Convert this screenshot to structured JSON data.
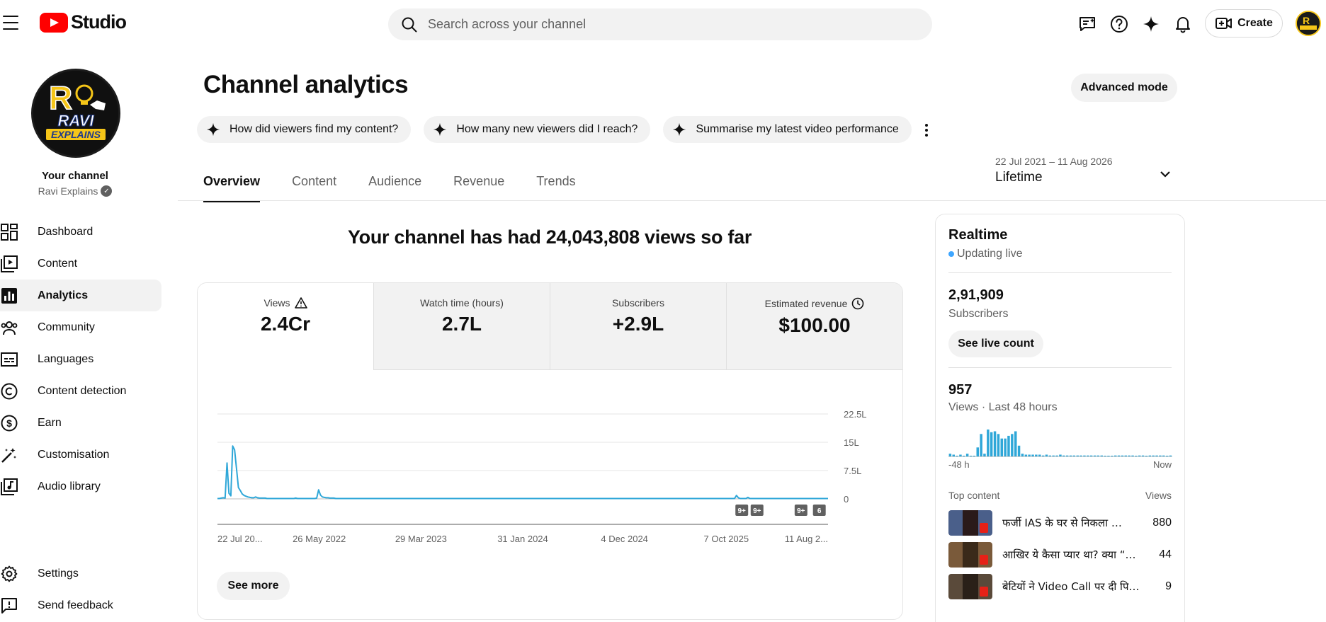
{
  "app": {
    "title": "Studio"
  },
  "search": {
    "placeholder": "Search across your channel"
  },
  "header": {
    "create_label": "Create"
  },
  "sidebar": {
    "your_channel": "Your channel",
    "channel_name": "Ravi Explains",
    "avatar_text": {
      "line1": "RAVI",
      "line2": "EXPLAINS"
    },
    "items": [
      {
        "label": "Dashboard",
        "icon": "dashboard-icon"
      },
      {
        "label": "Content",
        "icon": "content-icon"
      },
      {
        "label": "Analytics",
        "icon": "analytics-icon",
        "active": true
      },
      {
        "label": "Community",
        "icon": "community-icon"
      },
      {
        "label": "Languages",
        "icon": "subtitles-icon"
      },
      {
        "label": "Content detection",
        "icon": "copyright-icon"
      },
      {
        "label": "Earn",
        "icon": "dollar-icon"
      },
      {
        "label": "Customisation",
        "icon": "magic-wand-icon"
      },
      {
        "label": "Audio library",
        "icon": "audio-library-icon"
      }
    ],
    "bottom": [
      {
        "label": "Settings",
        "icon": "gear-icon"
      },
      {
        "label": "Send feedback",
        "icon": "feedback-icon"
      }
    ]
  },
  "main": {
    "title": "Channel analytics",
    "advanced_mode": "Advanced mode",
    "chips": [
      "How did viewers find my content?",
      "How many new viewers did I reach?",
      "Summarise my latest video performance"
    ],
    "tabs": [
      "Overview",
      "Content",
      "Audience",
      "Revenue",
      "Trends"
    ],
    "date_range": {
      "range": "22 Jul 2021 – 11 Aug 2026",
      "label": "Lifetime"
    },
    "headline": "Your channel has had 24,043,808 views so far",
    "metrics": [
      {
        "label": "Views",
        "value": "2.4Cr"
      },
      {
        "label": "Watch time (hours)",
        "value": "2.7L"
      },
      {
        "label": "Subscribers",
        "value": "+2.9L"
      },
      {
        "label": "Estimated revenue",
        "value": "$100.00"
      }
    ],
    "see_more": "See more"
  },
  "chart_data": {
    "type": "line",
    "series": [
      {
        "values": [
          0.1,
          0.1,
          0.2,
          0.3,
          0.2,
          9.5,
          1.5,
          0.8,
          14.0,
          13.0,
          8.0,
          3.0,
          2.2,
          1.3,
          0.9,
          0.7,
          0.5,
          0.4,
          0.3,
          0.3,
          0.5,
          0.3,
          0.2,
          0.2,
          0.2,
          0.2,
          0.1,
          0.1,
          0.1,
          0.1,
          0.1,
          0.1,
          0.1,
          0.1,
          0.1,
          0.1,
          0.1,
          0.1,
          0.1,
          0.1,
          0.1,
          0.2,
          0.1,
          0.1,
          0.1,
          0.1,
          0.1,
          0.1,
          0.1,
          0.1,
          0.1,
          0.1,
          0.2,
          2.4,
          1.0,
          0.5,
          0.4,
          0.3,
          0.3,
          0.2,
          0.2,
          0.2,
          0.1,
          0.1,
          0.1,
          0.1,
          0.1,
          0.1,
          0.1,
          0.1,
          0.1,
          0.1,
          0.1,
          0.1,
          0.1,
          0.1,
          0.1,
          0.1,
          0.1,
          0.1,
          0.1,
          0.1,
          0.1,
          0.1,
          0.1,
          0.1,
          0.1,
          0.1,
          0.1,
          0.1,
          0.1,
          0.1,
          0.1,
          0.1,
          0.1,
          0.1,
          0.1,
          0.1,
          0.1,
          0.1,
          0.1,
          0.1,
          0.1,
          0.1,
          0.1,
          0.1,
          0.1,
          0.1,
          0.1,
          0.1,
          0.1,
          0.1,
          0.1,
          0.1,
          0.1,
          0.1,
          0.1,
          0.1,
          0.1,
          0.1,
          0.1,
          0.1,
          0.1,
          0.1,
          0.1,
          0.1,
          0.1,
          0.1,
          0.1,
          0.1,
          0.1,
          0.1,
          0.1,
          0.1,
          0.1,
          0.1,
          0.1,
          0.1,
          0.1,
          0.1,
          0.1,
          0.1,
          0.1,
          0.1,
          0.1,
          0.1,
          0.1,
          0.1,
          0.1,
          0.1,
          0.1,
          0.1,
          0.1,
          0.1,
          0.1,
          0.1,
          0.1,
          0.1,
          0.1,
          0.1,
          0.1,
          0.1,
          0.1,
          0.1,
          0.1,
          0.1,
          0.1,
          0.1,
          0.1,
          0.1,
          0.1,
          0.1,
          0.1,
          0.1,
          0.1,
          0.1,
          0.1,
          0.1,
          0.1,
          0.1,
          0.1,
          0.1,
          0.1,
          0.1,
          0.1,
          0.1,
          0.1,
          0.1,
          0.1,
          0.1,
          0.1,
          0.1,
          0.1,
          0.1,
          0.1,
          0.1,
          0.1,
          0.1,
          0.1,
          0.1,
          0.1,
          0.1,
          0.1,
          0.1,
          0.1,
          0.1,
          0.1,
          0.1,
          0.1,
          0.1,
          0.1,
          0.1,
          0.1,
          0.1,
          0.1,
          0.1,
          0.1,
          0.1,
          0.1,
          0.1,
          0.1,
          0.1,
          0.1,
          0.1,
          0.1,
          0.1,
          0.1,
          0.1,
          0.1,
          0.1,
          0.1,
          0.1,
          0.1,
          0.1,
          0.1,
          0.1,
          0.1,
          0.1,
          0.1,
          0.1,
          0.1,
          0.1,
          0.1,
          0.1,
          0.1,
          0.1,
          0.1,
          0.1,
          0.1,
          0.1,
          0.1,
          0.1,
          0.1,
          0.1,
          0.1,
          0.1,
          0.1,
          0.1,
          0.1,
          0.1,
          0.1,
          0.1,
          0.1,
          0.1,
          0.1,
          0.1,
          0.1,
          0.1,
          0.1,
          0.1,
          0.1,
          0.1,
          0.9,
          0.3,
          0.1,
          0.1,
          0.1,
          0.1,
          0.4,
          0.1,
          0.1,
          0.1,
          0.1,
          0.1,
          0.1,
          0.1,
          0.1,
          0.1,
          0.1,
          0.1,
          0.1,
          0.1,
          0.1,
          0.1,
          0.1,
          0.1,
          0.1,
          0.1,
          0.1,
          0.1,
          0.1,
          0.1,
          0.1,
          0.1,
          0.1,
          0.1,
          0.1,
          0.1,
          0.1,
          0.1,
          0.1,
          0.1,
          0.1,
          0.1,
          0.1,
          0.1,
          0.1,
          0.1,
          0.1,
          0.1,
          0.1
        ]
      }
    ],
    "ytick_labels": [
      "0",
      "7.5L",
      "15L",
      "22.5L"
    ],
    "ytick_values": [
      0,
      7.5,
      15,
      22.5
    ],
    "ylim": [
      0,
      22.5
    ],
    "xtick_labels": [
      "22 Jul 20...",
      "26 May 2022",
      "29 Mar 2023",
      "31 Jan 2024",
      "4 Dec 2024",
      "7 Oct 2025",
      "11 Aug 2..."
    ],
    "markers": [
      "9+",
      "9+",
      "9+",
      "6"
    ],
    "grid": true,
    "color": "#2fa7d8"
  },
  "realtime": {
    "title": "Realtime",
    "updating": "Updating live",
    "subscribers_value": "2,91,909",
    "subscribers_label": "Subscribers",
    "see_live_count": "See live count",
    "views_value": "957",
    "views_label": "Views · Last 48 hours",
    "axis_start": "-48 h",
    "axis_end": "Now",
    "bars": [
      3,
      2,
      0,
      2,
      0,
      3,
      0,
      0,
      10,
      25,
      3,
      30,
      27,
      28,
      25,
      20,
      20,
      23,
      25,
      28,
      12,
      3,
      2,
      2,
      2,
      2,
      2,
      1,
      2,
      1,
      1,
      1,
      2,
      1,
      1,
      1,
      1,
      1,
      1,
      1,
      1,
      1,
      1,
      1,
      1,
      0,
      0,
      0,
      1,
      1,
      1,
      1,
      1,
      1,
      0,
      1,
      1,
      0,
      1,
      1,
      1,
      1,
      1,
      0,
      1
    ],
    "top_content_label": "Top content",
    "views_col": "Views",
    "top_content": [
      {
        "title": "फर्जी IAS के घर से निकला …",
        "views": "880",
        "color": "#4a5f8a"
      },
      {
        "title": "आखिर ये कैसा प्यार था? क्या “…",
        "views": "44",
        "color": "#7a5a3a"
      },
      {
        "title": "बेटियों ने Video Call पर दी पि…",
        "views": "9",
        "color": "#5a4a3a"
      }
    ]
  }
}
